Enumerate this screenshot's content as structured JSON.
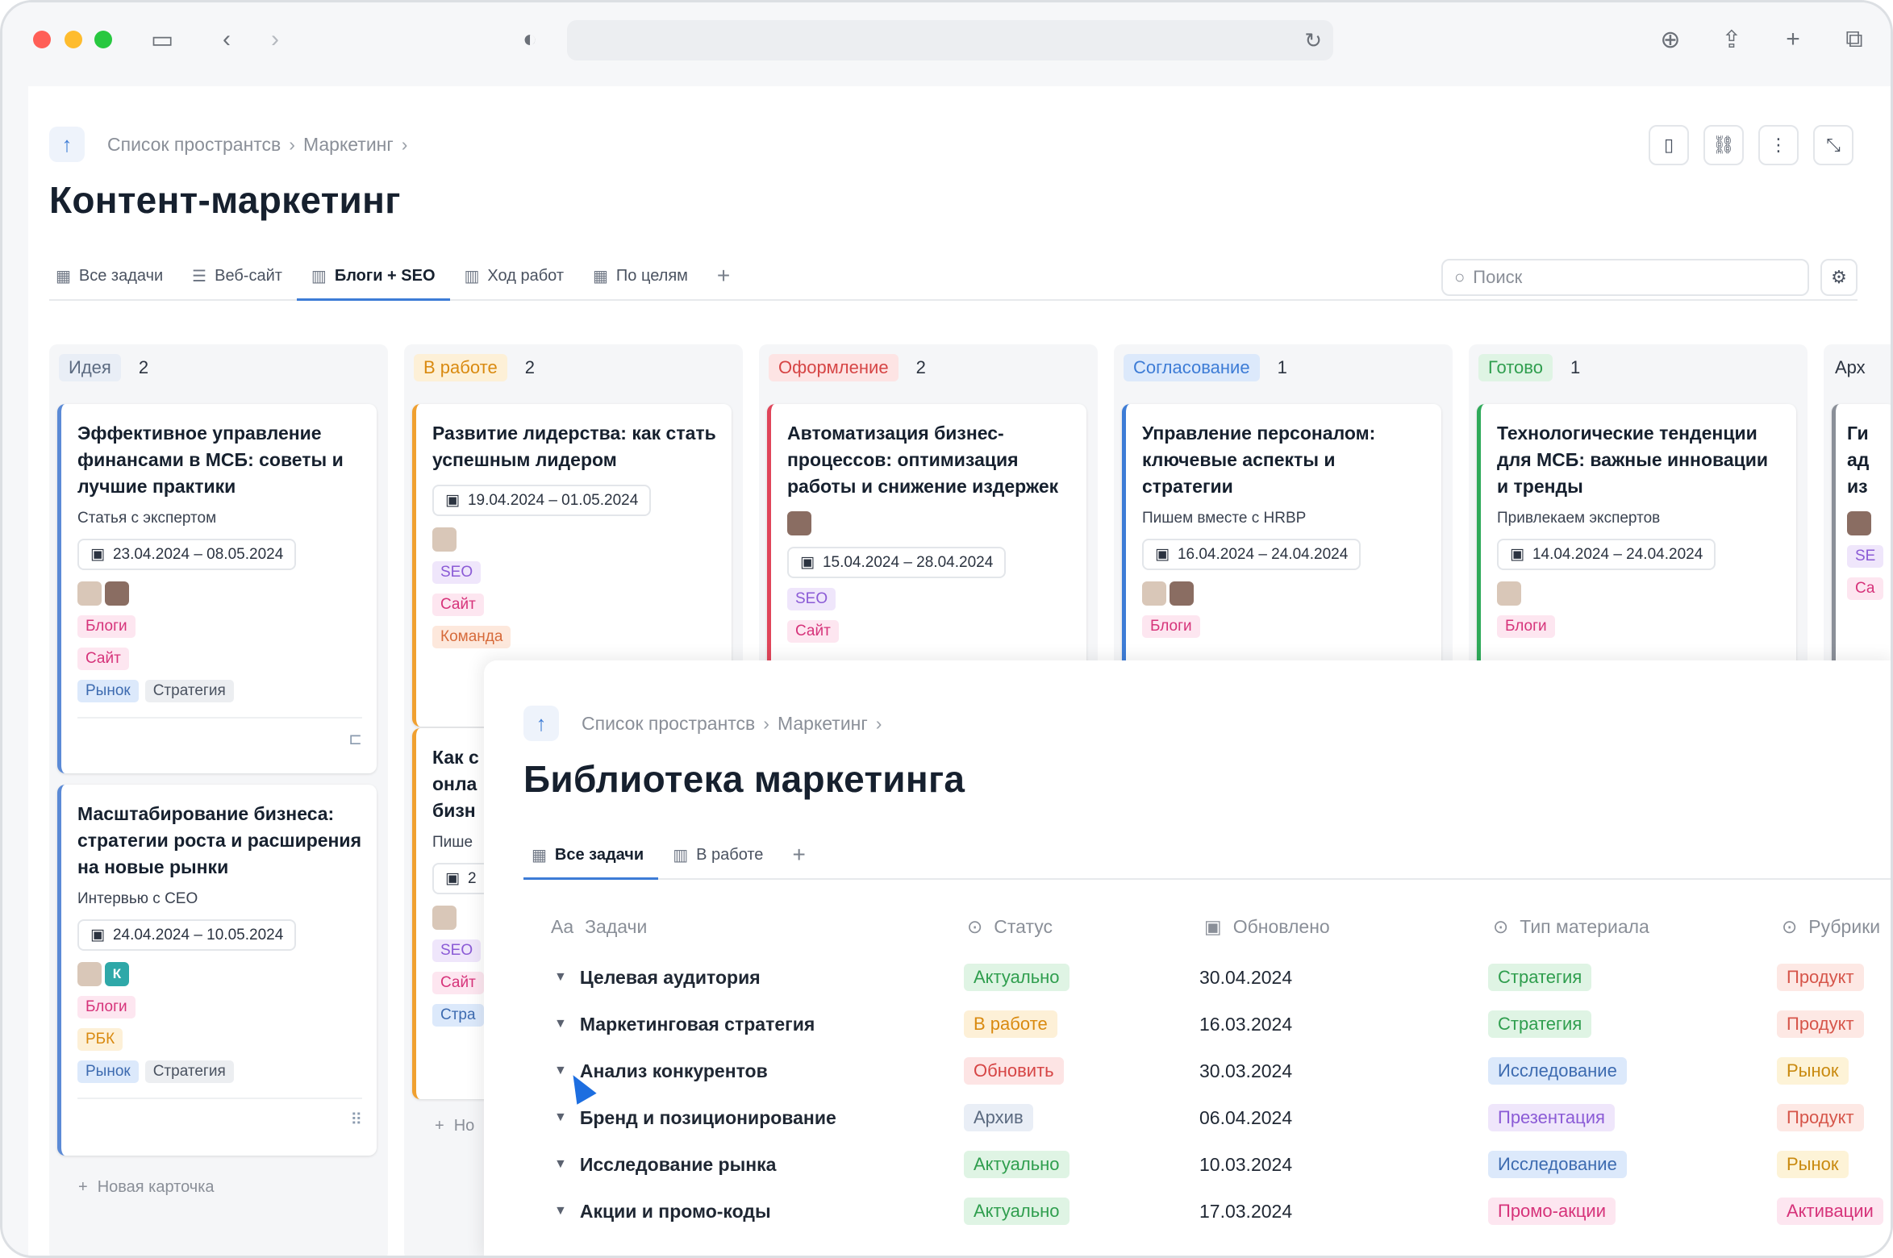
{
  "browser": {
    "icons": [
      "sidebar-icon",
      "back-icon",
      "forward-icon",
      "shield-icon",
      "reload-icon",
      "download-icon",
      "share-icon",
      "new-tab-icon",
      "tabs-overview-icon"
    ]
  },
  "board_page": {
    "breadcrumb": [
      "Список пространтсв",
      "Маркетинг"
    ],
    "title": "Контент-маркетинг",
    "tabs": [
      {
        "label": "Все задачи",
        "icon": "table-icon"
      },
      {
        "label": "Веб-сайт",
        "icon": "doc-icon"
      },
      {
        "label": "Блоги + SEO",
        "icon": "board-icon",
        "active": true
      },
      {
        "label": "Ход работ",
        "icon": "board-icon"
      },
      {
        "label": "По целям",
        "icon": "table-icon"
      }
    ],
    "search_placeholder": "Поиск",
    "new_card_label": "Новая карточка",
    "columns": [
      {
        "label": "Идея",
        "count": "2",
        "color": "#e9eef6",
        "text": "#5b6a80"
      },
      {
        "label": "В работе",
        "count": "2",
        "color": "#fdf0d7",
        "text": "#d98a10"
      },
      {
        "label": "Оформление",
        "count": "2",
        "color": "#fde4e4",
        "text": "#d64545"
      },
      {
        "label": "Согласование",
        "count": "1",
        "color": "#dce9fb",
        "text": "#3d7cd6"
      },
      {
        "label": "Готово",
        "count": "1",
        "color": "#dff4e4",
        "text": "#2f9e4e"
      },
      {
        "label": "Арх",
        "count": "",
        "color": "#f5f6f8",
        "text": "#2b3340"
      }
    ],
    "cards": {
      "idea_1": {
        "title": "Эффективное управление финансами в МСБ: советы и лучшие практики",
        "subtitle": "Статья с экспертом",
        "date": "23.04.2024 – 08.05.2024",
        "tags": [
          "Блоги",
          "Сайт"
        ],
        "tags2": [
          "Рынок",
          "Стратегия"
        ]
      },
      "idea_2": {
        "title": "Масштабирование бизнеса: стратегии роста и расширения на новые рынки",
        "subtitle": "Интервью с CEO",
        "date": "24.04.2024 – 10.05.2024",
        "avatar_letter": "К",
        "tags": [
          "Блоги",
          "РБК"
        ],
        "tags2": [
          "Рынок",
          "Стратегия"
        ]
      },
      "work_1": {
        "title": "Развитие лидерства: как стать успешным лидером",
        "date": "19.04.2024 – 01.05.2024",
        "tags": [
          "SEO",
          "Сайт",
          "Команда"
        ]
      },
      "work_2": {
        "title": "Как с онла бизн",
        "subtitle": "Пише",
        "date_partial": "2",
        "tags": [
          "SEO",
          "Сайт",
          "Стра"
        ],
        "new_label": "Но"
      },
      "design_1": {
        "title": "Автоматизация бизнес-процессов: оптимизация работы и снижение издержек",
        "date": "15.04.2024 – 28.04.2024",
        "tags": [
          "SEO",
          "Сайт"
        ]
      },
      "review_1": {
        "title": "Управление персоналом: ключевые аспекты и стратегии",
        "subtitle": "Пишем вместе с HRBP",
        "date": "16.04.2024 – 24.04.2024",
        "tags": [
          "Блоги"
        ]
      },
      "done_1": {
        "title": "Технологические тенденции для МСБ: важные инновации и тренды",
        "subtitle": "Привлекаем экспертов",
        "date": "14.04.2024 – 24.04.2024",
        "tags": [
          "Блоги"
        ]
      },
      "arch_1": {
        "title": "Ги ад из",
        "tags": [
          "SE",
          "Са"
        ]
      }
    }
  },
  "library": {
    "breadcrumb": [
      "Список пространтсв",
      "Маркетинг"
    ],
    "title": "Библиотека маркетинга",
    "tabs": [
      {
        "label": "Все задачи",
        "icon": "table-icon",
        "active": true
      },
      {
        "label": "В работе",
        "icon": "board-icon"
      }
    ],
    "columns": {
      "task": "Задачи",
      "status": "Статус",
      "updated": "Обновлено",
      "type": "Тип материала",
      "rubric": "Рубрики"
    },
    "rows": [
      {
        "task": "Целевая аудитория",
        "status": "Актуально",
        "updated": "30.04.2024",
        "type": "Стратегия",
        "rubric": "Продукт"
      },
      {
        "task": "Маркетинговая стратегия",
        "status": "В работе",
        "updated": "16.03.2024",
        "type": "Стратегия",
        "rubric": "Продукт"
      },
      {
        "task": "Анализ конкурентов",
        "status": "Обновить",
        "updated": "30.03.2024",
        "type": "Исследование",
        "rubric": "Рынок"
      },
      {
        "task": "Бренд и позиционирование",
        "status": "Архив",
        "updated": "06.04.2024",
        "type": "Презентация",
        "rubric": "Продукт"
      },
      {
        "task": "Исследование рынка",
        "status": "Актуально",
        "updated": "10.03.2024",
        "type": "Исследование",
        "rubric": "Рынок"
      },
      {
        "task": "Акции и промо-коды",
        "status": "Актуально",
        "updated": "17.03.2024",
        "type": "Промо-акции",
        "rubric": "Активации"
      }
    ]
  },
  "colors": {
    "accent": "#3d7cd6",
    "tag_blog": "#fde6f0",
    "tag_blog_text": "#d6337a",
    "tag_site": "#fde6f0",
    "tag_market": "#dce9fb",
    "tag_strategy": "#eceef1",
    "tag_seo": "#efe6fb",
    "tag_seo_text": "#8b5bd6",
    "tag_team": "#fde8dc",
    "tag_team_text": "#d66a3a"
  }
}
